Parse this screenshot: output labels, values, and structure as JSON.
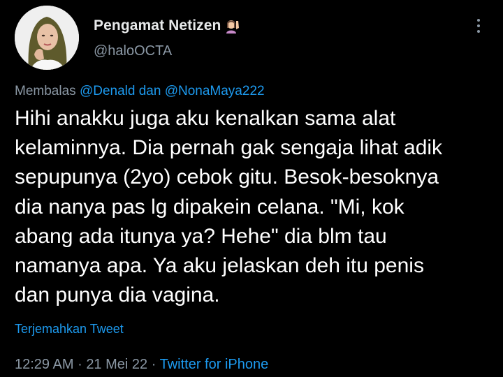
{
  "author": {
    "display_name": "Pengamat Netizen",
    "emoji": "woman-raising-hand-icon",
    "handle": "@haloOCTA"
  },
  "reply": {
    "prefix": "Membalas",
    "mention_1": "@Denald",
    "conjunction": "dan",
    "mention_2": "@NonaMaya222"
  },
  "tweet": {
    "lines": [
      "Hihi anakku juga aku kenalkan sama alat",
      "kelaminnya. Dia pernah gak sengaja lihat adik",
      "sepupunya (2yo) cebok gitu. Besok-besoknya",
      "dia nanya pas lg dipakein celana. \"Mi, kok",
      "abang ada itunya ya? Hehe\" dia blm tau",
      "namanya apa. Ya aku jelaskan deh itu penis",
      "dan punya dia vagina."
    ]
  },
  "translate_label": "Terjemahkan Tweet",
  "meta": {
    "time": "12:29 AM",
    "dot_1": "·",
    "date": "21 Mei 22",
    "dot_2": "·",
    "source": "Twitter for iPhone"
  },
  "colors": {
    "background": "#000000",
    "text": "#ffffff",
    "secondary": "#8b98a5",
    "link": "#1d9bf0"
  }
}
